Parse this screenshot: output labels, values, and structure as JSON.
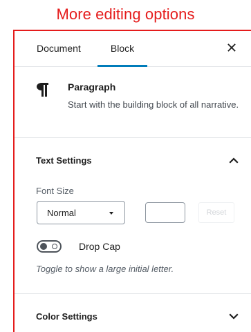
{
  "caption": "More editing options",
  "tabs": {
    "document_label": "Document",
    "block_label": "Block",
    "active": "Block"
  },
  "close_icon": "close-icon",
  "block": {
    "icon": "paragraph-icon",
    "title": "Paragraph",
    "description": "Start with the building block of all narrative."
  },
  "text_settings": {
    "title": "Text Settings",
    "expanded": true,
    "font_size_label": "Font Size",
    "font_size_value": "Normal",
    "custom_size_value": "",
    "reset_label": "Reset",
    "drop_cap_label": "Drop Cap",
    "drop_cap_enabled": false,
    "drop_cap_help": "Toggle to show a large initial letter."
  },
  "color_settings": {
    "title": "Color Settings",
    "expanded": false
  },
  "colors": {
    "accent": "#007cba",
    "highlight": "#e51c1c",
    "border": "#e2e4e7"
  }
}
